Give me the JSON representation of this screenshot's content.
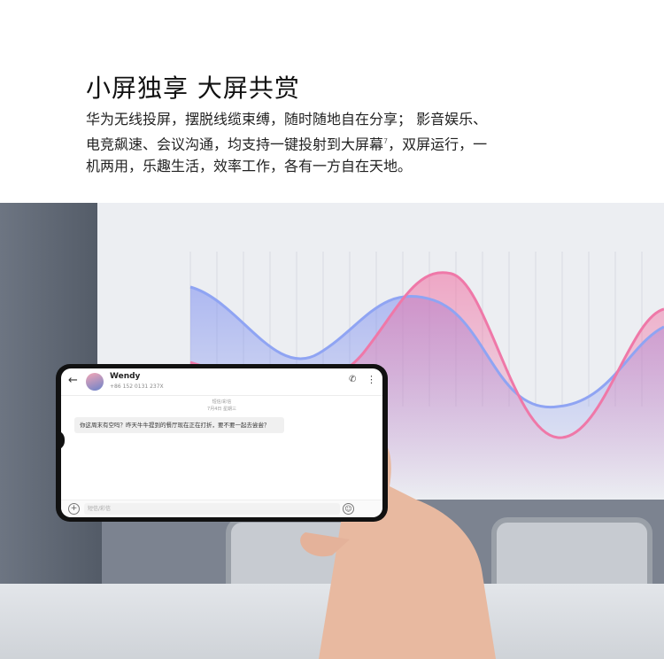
{
  "headline": "小屏独享 大屏共赏",
  "description": {
    "line1": "华为无线投屏，摆脱线缆束缚，随时随地自在分享； 影音娱乐、",
    "line2": "电竞飙速、会议沟通，均支持一键投射到大屏幕",
    "footnote": "7",
    "line2_end": "，双屏运行，一",
    "line3": "机两用，乐趣生活，效率工作，各有一方自在天地。"
  },
  "phone": {
    "contact_name": "Wendy",
    "contact_number": "+86 152 0131 237X",
    "meta_label": "短信/彩信",
    "meta_time": "7月4日 星期三",
    "message": "你这周末有空吗？昨天牛牛提到的餐厅现在正在打折，要不要一起去尝尝？",
    "input_placeholder": "短信/彩信",
    "icons": [
      "back-arrow-icon",
      "avatar",
      "phone-icon",
      "more-icon",
      "plus-icon",
      "emoji-icon"
    ]
  },
  "colors": {
    "wave_pink": "#f06ca0",
    "wave_blue": "#7b8df0"
  }
}
